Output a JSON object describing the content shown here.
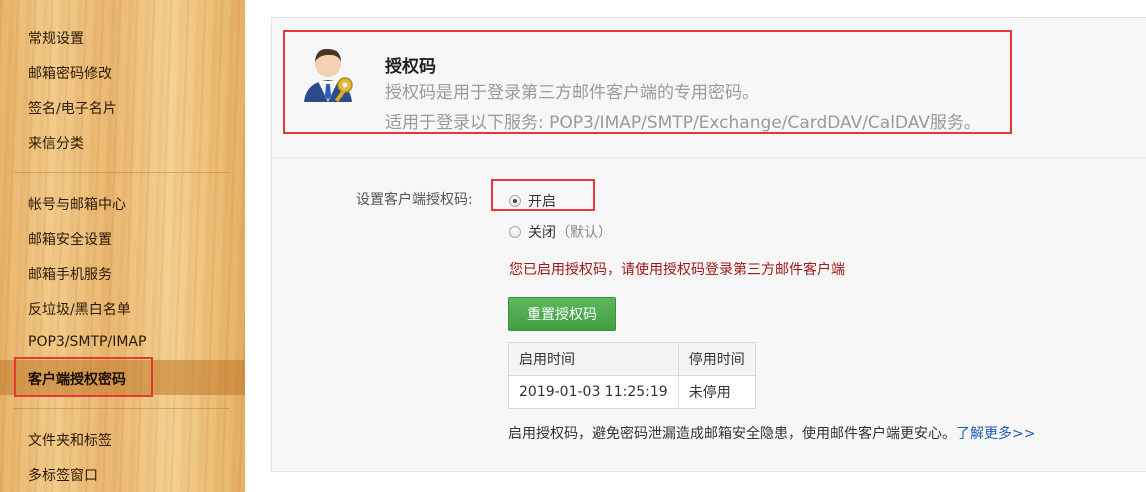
{
  "sidebar": {
    "group1": [
      "常规设置",
      "邮箱密码修改",
      "签名/电子名片",
      "来信分类"
    ],
    "group2": [
      "帐号与邮箱中心",
      "邮箱安全设置",
      "邮箱手机服务",
      "反垃圾/黑白名单",
      "POP3/SMTP/IMAP",
      "客户端授权密码"
    ],
    "group3": [
      "文件夹和标签",
      "多标签窗口"
    ],
    "active_item": "客户端授权密码"
  },
  "header": {
    "title": "授权码",
    "desc1": "授权码是用于登录第三方邮件客户端的专用密码。",
    "desc2": "适用于登录以下服务: POP3/IMAP/SMTP/Exchange/CardDAV/CalDAV服务。",
    "icon": "user-with-key-icon"
  },
  "form": {
    "label": "设置客户端授权码:",
    "option_on": "开启",
    "option_off": "关闭",
    "option_off_hint": "（默认）",
    "selected": "开启",
    "notice": "您已启用授权码，请使用授权码登录第三方邮件客户端",
    "reset_button": "重置授权码"
  },
  "table": {
    "headers": [
      "启用时间",
      "停用时间"
    ],
    "rows": [
      [
        "2019-01-03 11:25:19",
        "未停用"
      ]
    ]
  },
  "footer": {
    "note": "启用授权码，避免密码泄漏造成邮箱安全隐患，使用邮件客户端更安心。",
    "link": "了解更多>>"
  },
  "colors": {
    "highlight_box": "#e53935",
    "notice_text": "#a21717",
    "button_green": "#4cae4c",
    "link_blue": "#1e5eb3"
  }
}
